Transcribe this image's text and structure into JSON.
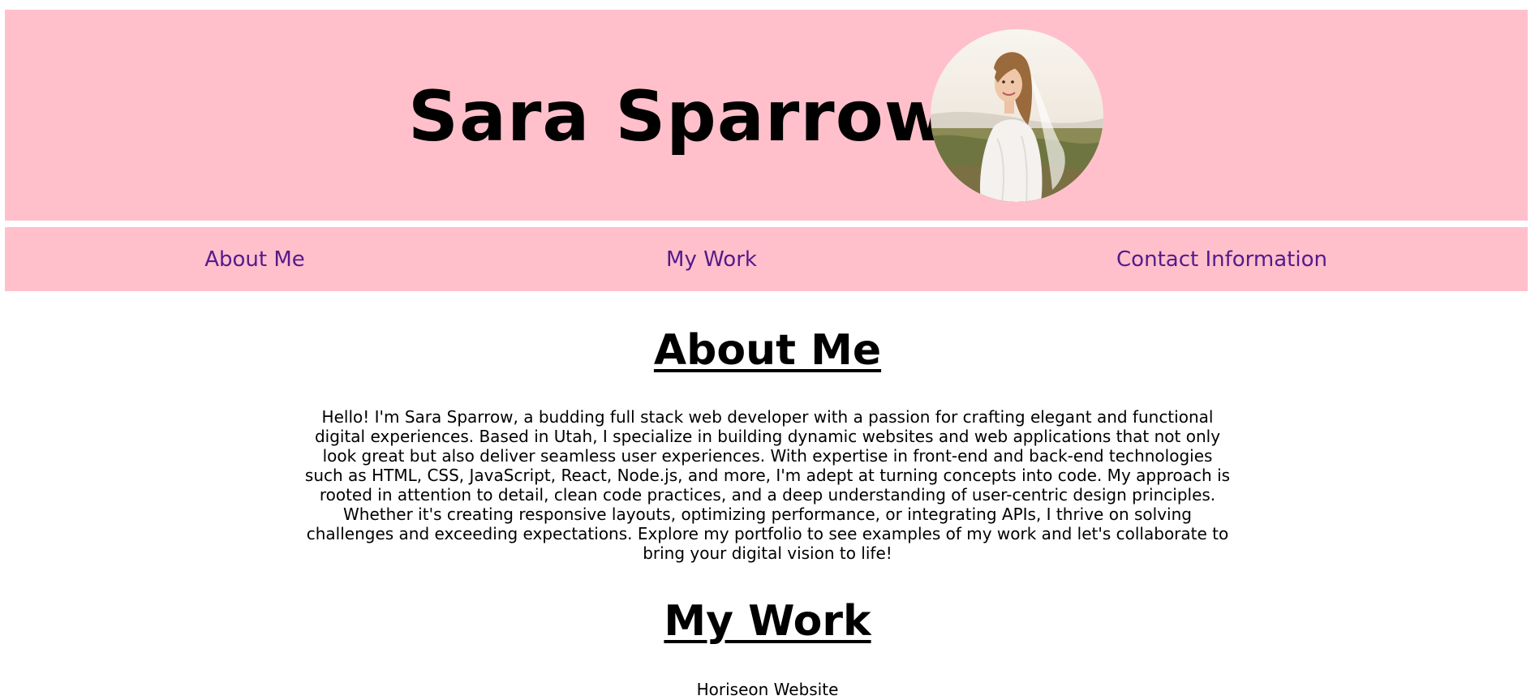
{
  "header": {
    "title": "Sara Sparrow",
    "avatar_icon": "profile-photo"
  },
  "nav": {
    "items": [
      {
        "label": "About Me"
      },
      {
        "label": "My Work"
      },
      {
        "label": "Contact Information"
      }
    ]
  },
  "about": {
    "heading": "About Me",
    "text": "Hello! I'm Sara Sparrow, a budding full stack web developer with a passion for crafting elegant and functional digital experiences. Based in Utah, I specialize in building dynamic websites and web applications that not only look great but also deliver seamless user experiences. With expertise in front-end and back-end technologies such as HTML, CSS, JavaScript, React, Node.js, and more, I'm adept at turning concepts into code. My approach is rooted in attention to detail, clean code practices, and a deep understanding of user-centric design principles. Whether it's creating responsive layouts, optimizing performance, or integrating APIs, I thrive on solving challenges and exceeding expectations. Explore my portfolio to see examples of my work and let's collaborate to bring your digital vision to life!"
  },
  "work": {
    "heading": "My Work",
    "items": [
      {
        "label": "Horiseon Website"
      }
    ]
  },
  "colors": {
    "header_background": "#ffc0cb",
    "nav_link": "#551a8b",
    "page_background": "#ffffff"
  }
}
